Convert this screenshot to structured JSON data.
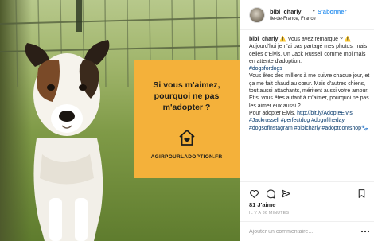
{
  "post": {
    "promo_lines": [
      "Si vous m'aimez,",
      "pourquoi ne pas",
      "m'adopter ?"
    ],
    "promo_url": "AGIRPOURLADOPTION.FR",
    "icons": {
      "house": "house-heart-icon"
    },
    "colors": {
      "card": "#f4b13a",
      "grass": "#6f8a3e"
    }
  },
  "header": {
    "username": "bibi_charly",
    "separator": "•",
    "follow_label": "S'abonner",
    "location": "Ile-de-France, France"
  },
  "caption": {
    "username": "bibi_charly",
    "line1": "⚠️ Vous avez remarqué ? ⚠️",
    "line2": "Aujourd'hui je n'ai pas partagé mes photos, mais celles d'Elvis. Un Jack Russell comme moi mais en attente d'adoption.",
    "tag1": "#dogsfordogs",
    "paragraph2": "Vous êtes des milliers à me suivre chaque jour, et ça me fait chaud au cœur. Mais d'autres chiens, tout aussi attachants, méritent aussi votre amour. Et si vous êtes autant à m'aimer, pourquoi ne pas les aimer eux aussi ?",
    "adopt_prefix": "Pour adopter Elvis, ",
    "adopt_link": "http://bit.ly/AdopteElvis",
    "tags2": "#Jackrussell #perfectdog #dogoftheday #dogsofinstagram #bibicharly #adoptdontshop",
    "paw": "🐾"
  },
  "actions": {
    "icons": [
      "heart-icon",
      "comment-icon",
      "share-icon",
      "bookmark-icon"
    ]
  },
  "likes": "81 J'aime",
  "timestamp": "IL Y A 36 MINUTES",
  "comment": {
    "placeholder": "Ajouter un commentaire...",
    "more_icon": "more-icon"
  }
}
